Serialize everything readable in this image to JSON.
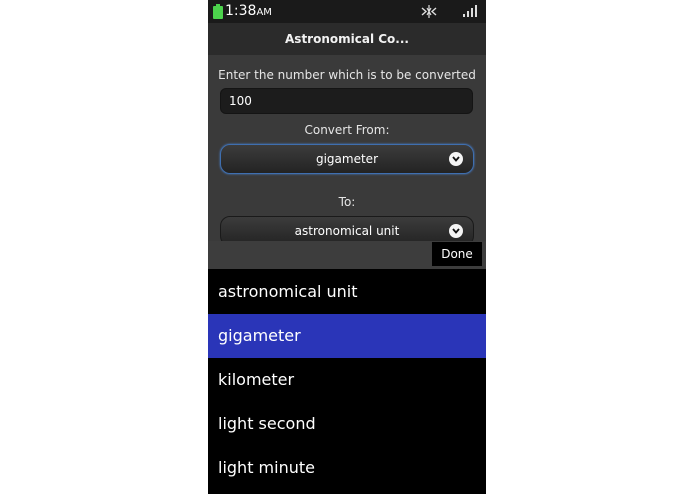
{
  "status_bar": {
    "time": "1:38",
    "ampm": "AM",
    "icons": [
      "battery-icon",
      "bluetooth-icon",
      "signal-icon"
    ]
  },
  "titlebar": {
    "title": "Astronomical Co..."
  },
  "form": {
    "number_label": "Enter the number which is to be converted",
    "number_value": "100",
    "from_label": "Convert From:",
    "from_selected": "gigameter",
    "to_label": "To:",
    "to_selected": "astronomical unit"
  },
  "picker": {
    "done_label": "Done",
    "options": [
      {
        "label": "astronomical unit",
        "selected": false
      },
      {
        "label": "gigameter",
        "selected": true
      },
      {
        "label": "kilometer",
        "selected": false
      },
      {
        "label": "light second",
        "selected": false
      },
      {
        "label": "light minute",
        "selected": false
      }
    ]
  },
  "colors": {
    "selection": "#2a35b8",
    "focus_border": "#3f6fb0",
    "battery": "#4cd24c"
  }
}
